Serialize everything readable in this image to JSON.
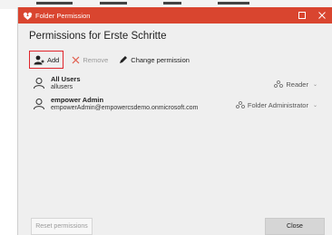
{
  "window": {
    "title": "Folder Permission",
    "accent": "#d9452f"
  },
  "heading": "Permissions for Erste Schritte",
  "toolbar": {
    "add_label": "Add",
    "remove_label": "Remove",
    "change_label": "Change permission"
  },
  "permissions": [
    {
      "name": "All Users",
      "detail": "allusers",
      "role": "Reader"
    },
    {
      "name": "empower Admin",
      "detail": "empowerAdmin@empowercsdemo.onmicrosoft.com",
      "role": "Folder Administrator"
    }
  ],
  "footer": {
    "reset_label": "Reset permissions",
    "close_label": "Close"
  }
}
